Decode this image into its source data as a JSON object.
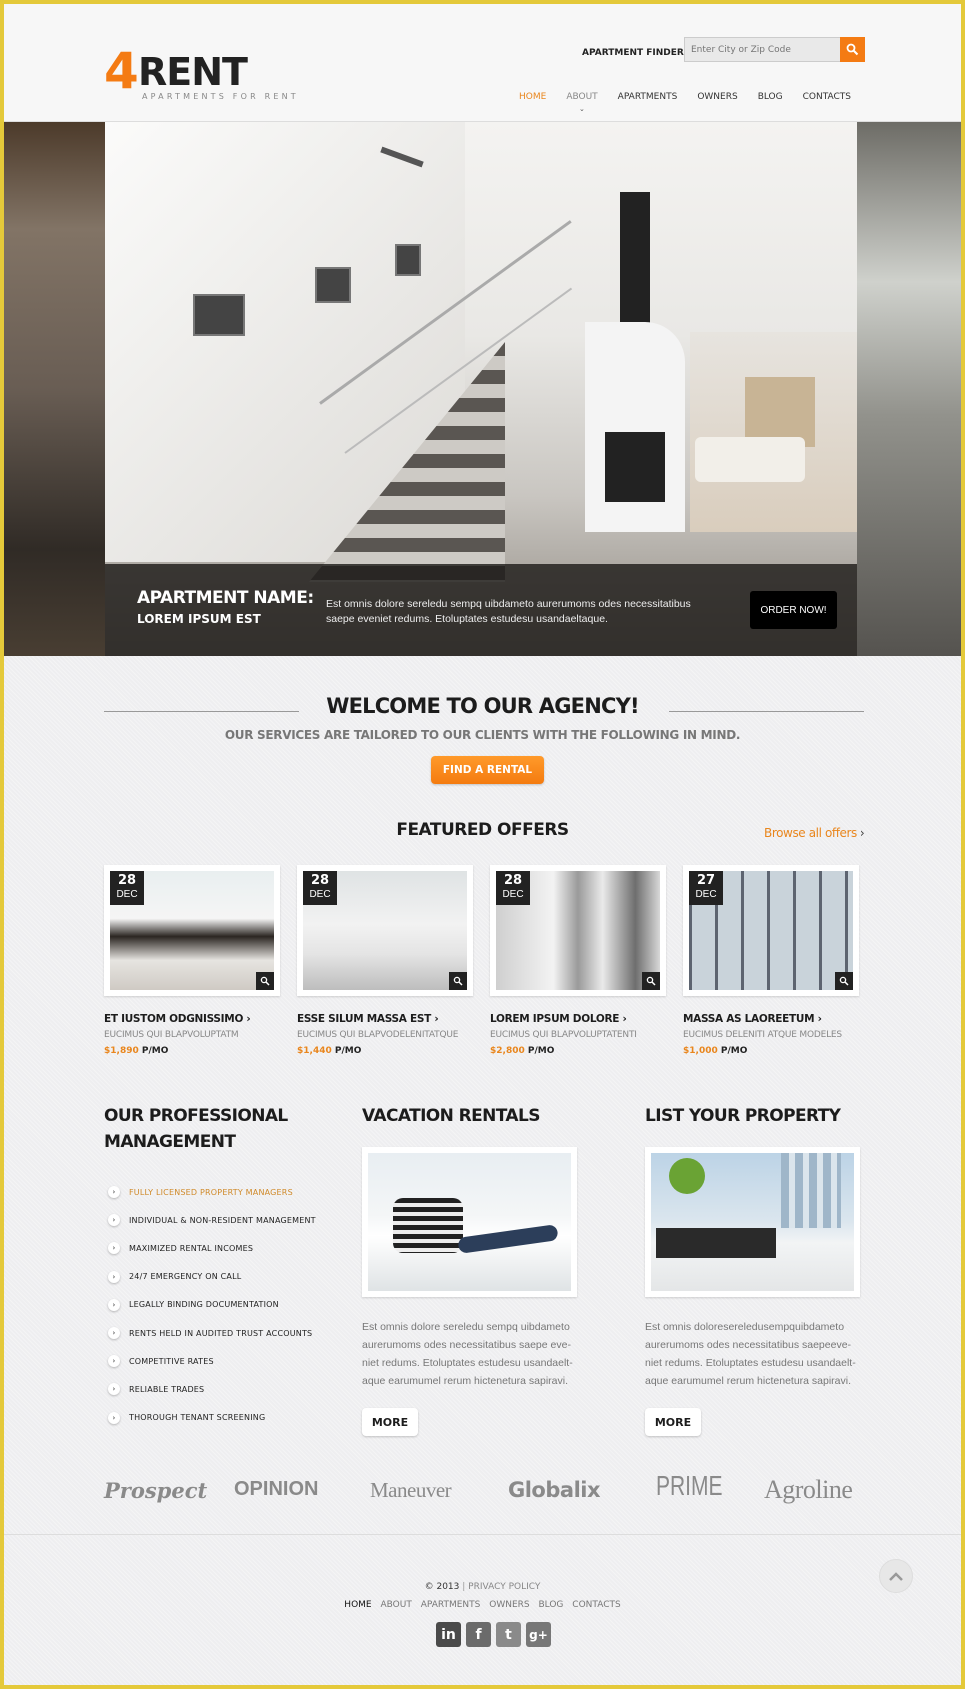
{
  "header": {
    "logo_number": "4",
    "logo_word": "RENT",
    "logo_tagline": "APARTMENTS FOR RENT",
    "finder_label": "APARTMENT FINDER",
    "finder_placeholder": "Enter City or Zip Code",
    "finder_button_icon": "search-icon",
    "nav": [
      {
        "label": "HOME",
        "state": "active"
      },
      {
        "label": "ABOUT",
        "state": "has-submenu"
      },
      {
        "label": "APARTMENTS",
        "state": "normal"
      },
      {
        "label": "OWNERS",
        "state": "normal"
      },
      {
        "label": "BLOG",
        "state": "normal"
      },
      {
        "label": "CONTACTS",
        "state": "normal"
      }
    ]
  },
  "hero": {
    "title": "APARTMENT NAME:",
    "subtitle": "LOREM IPSUM EST",
    "text": "Est omnis dolore sereledu sempq uibdameto aurerumoms odes necessitatibus saepe eveniet redums. Etoluptates estudesu usandaeltaque.",
    "button": "ORDER NOW!"
  },
  "welcome": {
    "title": "WELCOME TO OUR AGENCY!",
    "subtitle": "OUR SERVICES ARE TAILORED TO OUR CLIENTS WITH THE FOLLOWING IN MIND.",
    "button": "FIND A RENTAL"
  },
  "featured": {
    "title": "FEATURED OFFERS",
    "browse_link": "Browse all offers",
    "browse_chevron": "›",
    "offers": [
      {
        "day": "28",
        "month": "DEC",
        "name": "ET IUSTOM ODGNISSIMO ›",
        "sub": "EUCIMUS QUI BLAPVOLUPTATM",
        "price": "$1,890",
        "unit": " P/MO"
      },
      {
        "day": "28",
        "month": "DEC",
        "name": "ESSE SILUM MASSA EST ›",
        "sub": "EUCIMUS QUI BLAPVODELENITATQUE",
        "price": "$1,440",
        "unit": " P/MO"
      },
      {
        "day": "28",
        "month": "DEC",
        "name": "LOREM IPSUM DOLORE ›",
        "sub": "EUCIMUS QUI BLAPVOLUPTATENTI",
        "price": "$2,800",
        "unit": " P/MO"
      },
      {
        "day": "27",
        "month": "DEC",
        "name": "MASSA AS LAOREETUM ›",
        "sub": "EUCIMUS DELENITI ATQUE MODELES",
        "price": "$1,000",
        "unit": " P/MO"
      }
    ]
  },
  "management": {
    "title_line1": "OUR PROFESSIONAL",
    "title_line2": "MANAGEMENT",
    "items": [
      "FULLY LICENSED PROPERTY MANAGERS",
      "INDIVIDUAL & NON-RESIDENT MANAGEMENT",
      "MAXIMIZED RENTAL INCOMES",
      "24/7 EMERGENCY ON CALL",
      "LEGALLY BINDING DOCUMENTATION",
      "RENTS HELD IN AUDITED TRUST ACCOUNTS",
      "COMPETITIVE RATES",
      "RELIABLE TRADES",
      "THOROUGH TENANT SCREENING"
    ]
  },
  "vacation": {
    "title": "VACATION RENTALS",
    "text": "Est omnis dolore sereledu sempq uibdameto aurerumoms odes necessitatibus saepe eve-niet redums. Etoluptates estudesu usandaelt-aque earumumel rerum hictenetura sapiravi.",
    "button": "MORE"
  },
  "list_property": {
    "title": "LIST YOUR PROPERTY",
    "text": "Est omnis doloresereledusempquibdameto aurerumoms odes necessitatibus saepeeve-niet redums. Etoluptates estudesu usandaelt-aque earumumel rerum hictenetura sapiravi.",
    "button": "MORE"
  },
  "partners": [
    "Prospect",
    "OPINION",
    "Maneuver",
    "Globalix",
    "PRIME",
    "Agroline"
  ],
  "footer": {
    "copyright": "© 2013",
    "separator": "|",
    "privacy": "PRIVACY POLICY",
    "nav": [
      "HOME",
      "ABOUT",
      "APARTMENTS",
      "OWNERS",
      "BLOG",
      "CONTACTS"
    ],
    "social": [
      {
        "icon": "linkedin-icon",
        "glyph": "in",
        "color": "#4a4a4a"
      },
      {
        "icon": "facebook-icon",
        "glyph": "f",
        "color": "#6b6b6b"
      },
      {
        "icon": "twitter-icon",
        "glyph": "t",
        "color": "#8a8a8a"
      },
      {
        "icon": "google-plus-icon",
        "glyph": "g+",
        "color": "#777777"
      }
    ]
  },
  "colors": {
    "accent": "#f47b13",
    "link": "#e9861d",
    "frame": "#e4c93a",
    "text_dark": "#1c1c1c"
  }
}
